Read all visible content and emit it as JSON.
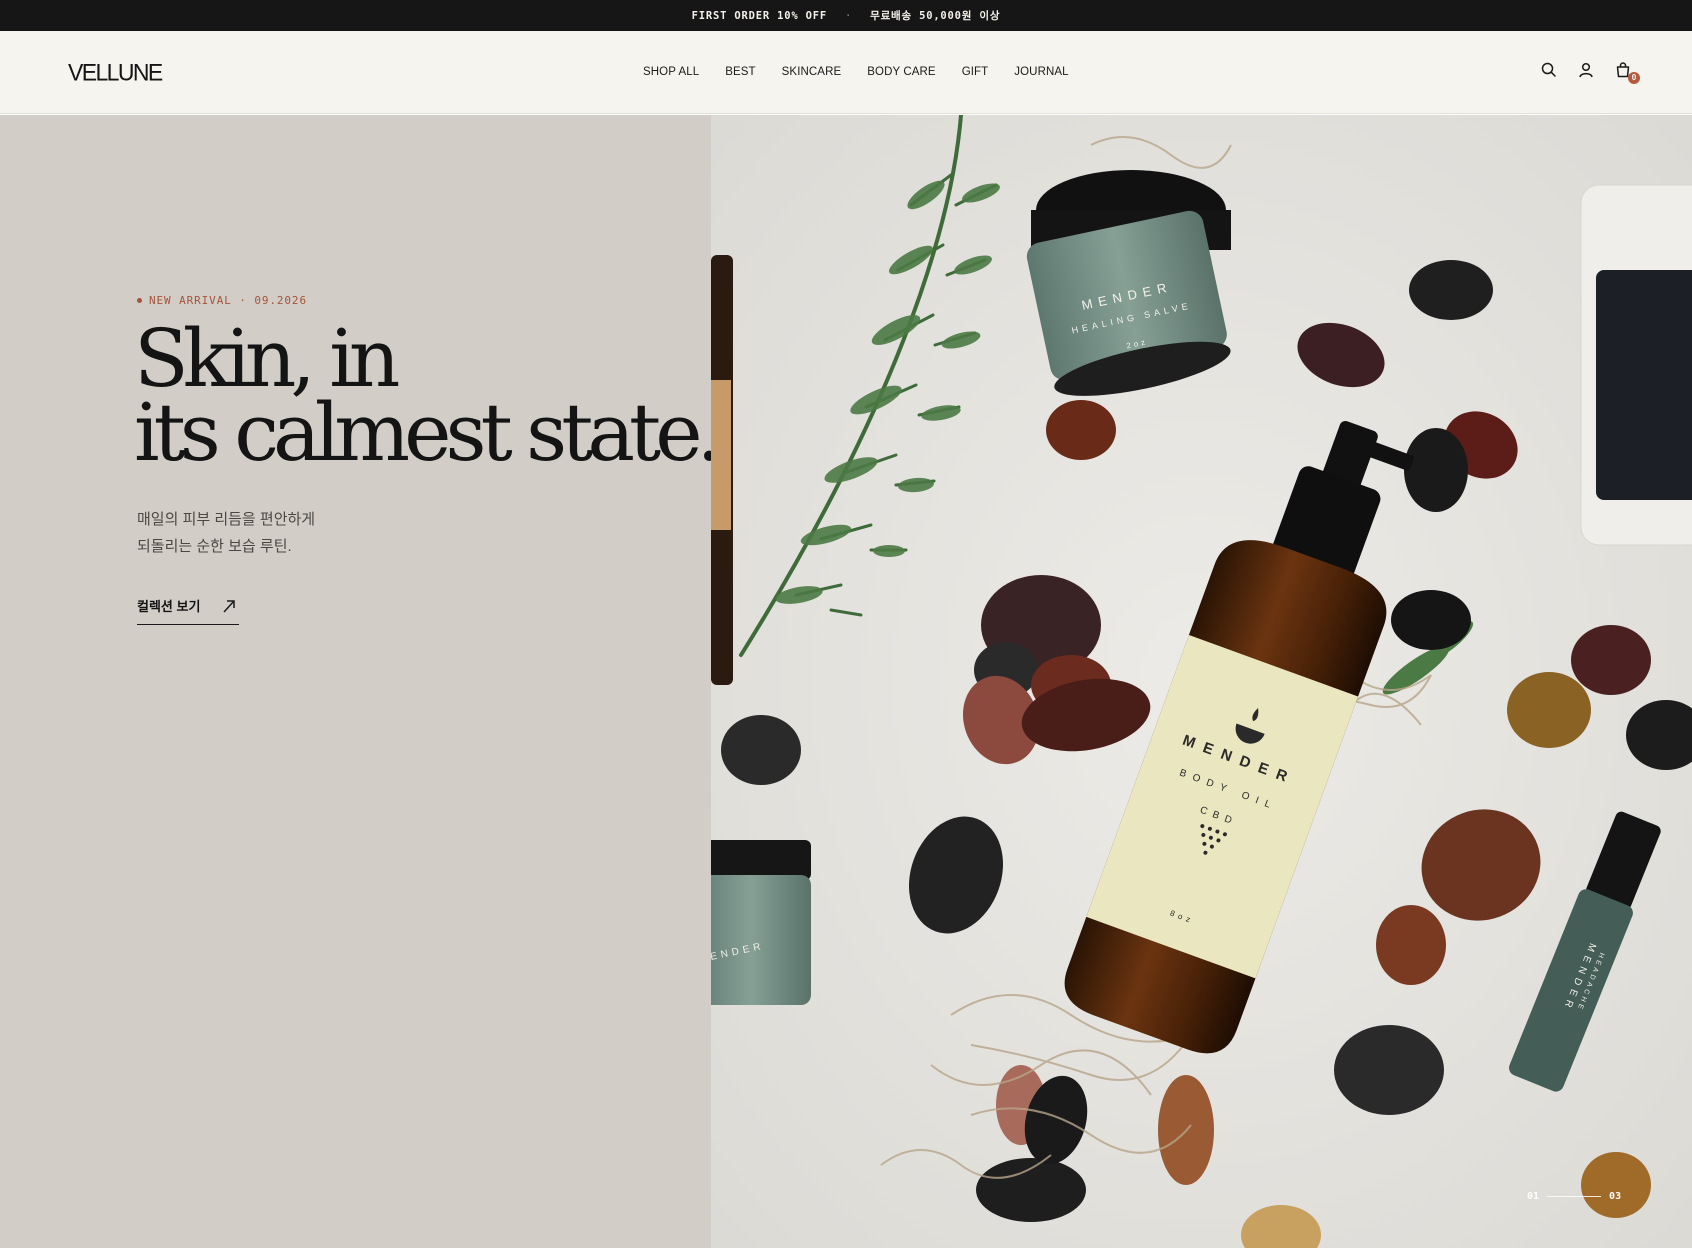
{
  "announcement": {
    "offer": "FIRST ORDER 10% OFF",
    "separator": "·",
    "shipping": "무료배송 50,000원 이상"
  },
  "header": {
    "logo": "VELLUNE",
    "nav": [
      "SHOP ALL",
      "BEST",
      "SKINCARE",
      "BODY CARE",
      "GIFT",
      "JOURNAL"
    ],
    "cart_count": "0",
    "icons": [
      "search-icon",
      "account-icon",
      "cart-icon"
    ]
  },
  "hero": {
    "eyebrow": "NEW ARRIVAL · 09.2026",
    "headline_line1": "Skin, in",
    "headline_line2": "its calmest state.",
    "subtitle_line1": "매일의 피부 리듬을 편안하게",
    "subtitle_line2": "되돌리는 순한 보습 루틴.",
    "cta_label": "컬렉션 보기",
    "cta_icon": "arrow-up-right-icon",
    "slide_current": "01",
    "slide_total": "03",
    "product_labels": {
      "body_oil_brand": "MENDER",
      "body_oil_type": "BODY OIL",
      "body_oil_cbd": "CBD",
      "body_oil_size": "8oz",
      "salve_brand": "MENDER",
      "salve_type": "HEALING SALVE",
      "salve_size": "2oz",
      "roller_brand": "MENDER",
      "roller_type": "HEADACHE"
    }
  },
  "colors": {
    "announce_bg": "#161616",
    "header_bg": "#f6f4ef",
    "hero_left_bg": "#d2cec7",
    "accent": "#a5533a",
    "badge": "#b35a3f"
  }
}
